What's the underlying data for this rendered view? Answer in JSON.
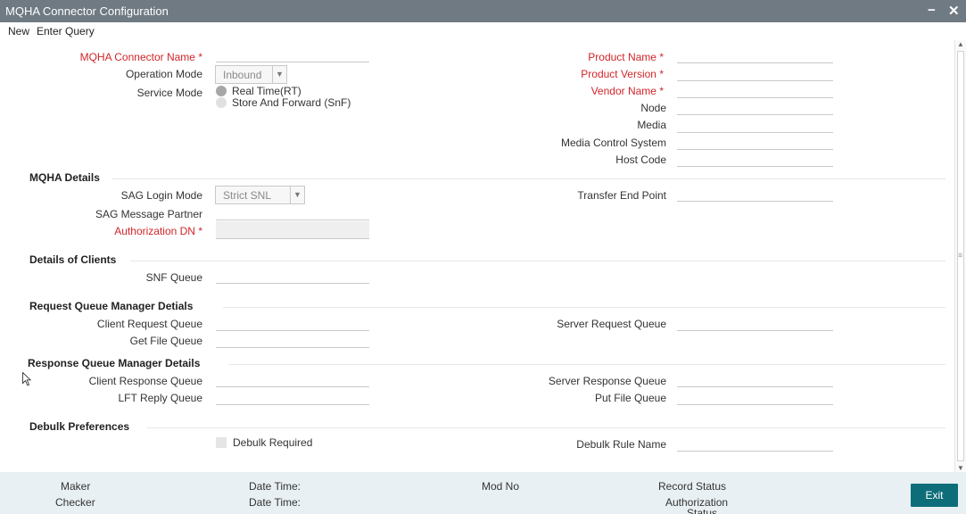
{
  "window": {
    "title": "MQHA Connector Configuration",
    "minimize": "−",
    "close": "✕"
  },
  "menu": {
    "new": "New",
    "enter_query": "Enter Query"
  },
  "header": {
    "connector_name": "MQHA Connector Name",
    "operation_mode": "Operation Mode",
    "operation_mode_value": "Inbound",
    "service_mode": "Service Mode",
    "service_mode_rt": "Real Time(RT)",
    "service_mode_snf": "Store And Forward (SnF)",
    "product_name": "Product Name",
    "product_version": "Product Version",
    "vendor_name": "Vendor Name",
    "node": "Node",
    "media": "Media",
    "media_control_system": "Media Control System",
    "host_code": "Host Code",
    "required_mark": "*"
  },
  "mqha_details": {
    "title": "MQHA Details",
    "sag_login_mode": "SAG Login Mode",
    "sag_login_mode_value": "Strict SNL",
    "sag_message_partner": "SAG Message Partner",
    "authorization_dn": "Authorization DN",
    "transfer_end_point": "Transfer End Point"
  },
  "clients": {
    "title": "Details of Clients",
    "snf_queue": "SNF Queue"
  },
  "request_queue": {
    "title": "Request Queue Manager Detials",
    "client_request_queue": "Client Request Queue",
    "get_file_queue": "Get File Queue",
    "server_request_queue": "Server Request Queue"
  },
  "response_queue": {
    "title": "Response Queue Manager Details",
    "client_response_queue": "Client Response Queue",
    "lft_reply_queue": "LFT Reply Queue",
    "server_response_queue": "Server Response Queue",
    "put_file_queue": "Put File Queue"
  },
  "debulk": {
    "title": "Debulk Preferences",
    "debulk_required": "Debulk Required",
    "debulk_rule_name": "Debulk Rule Name"
  },
  "footer": {
    "maker": "Maker",
    "checker": "Checker",
    "date_time_1": "Date Time:",
    "date_time_2": "Date Time:",
    "mod_no": "Mod No",
    "record_status": "Record Status",
    "authorization_status_line1": "Authorization",
    "authorization_status_line2": "Status",
    "exit": "Exit"
  },
  "icons": {
    "scroll_up": "▲",
    "scroll_down": "▼",
    "scroll_grip": "≡",
    "dropdown": "▼"
  },
  "colors": {
    "titlebar": "#6f7a83",
    "required_label": "#d0262a",
    "footer_bg": "#e9f0f3",
    "exit_button": "#0d6e7a"
  }
}
